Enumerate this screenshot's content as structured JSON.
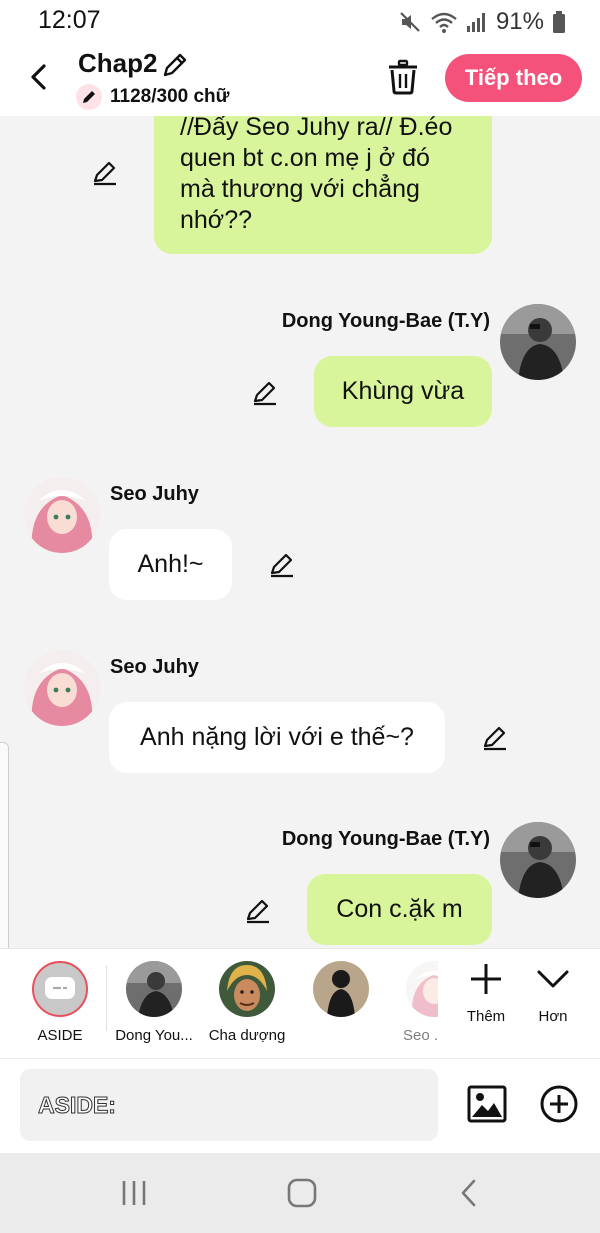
{
  "status_bar": {
    "time": "12:07",
    "battery": "91%",
    "icons": [
      "mute-icon",
      "wifi-icon",
      "signal-icon",
      "battery-icon"
    ]
  },
  "header": {
    "title": "Chap2",
    "word_count": "1128/300 chữ",
    "next_label": "Tiếp theo",
    "accent_color": "#f4527a"
  },
  "messages": [
    {
      "side": "right",
      "text": "//Đấy Seo Juhy ra// Đ.éo quen bt c.on mẹ j ở đó mà thương với chẳng nhớ??"
    },
    {
      "side": "right",
      "sender": "Dong Young-Bae (T.Y)",
      "text": "Khùng vừa"
    },
    {
      "side": "left",
      "sender": "Seo Juhy",
      "text": "Anh!~"
    },
    {
      "side": "left",
      "sender": "Seo Juhy",
      "text": "Anh nặng lời với e thế~?"
    },
    {
      "side": "right",
      "sender": "Dong Young-Bae (T.Y)",
      "text": "Con c.ặk m"
    }
  ],
  "character_bar": {
    "characters": [
      {
        "label": "ASIDE"
      },
      {
        "label": "Dong You..."
      },
      {
        "label": "Cha dượng"
      },
      {
        "label": ""
      },
      {
        "label": "Seo ."
      }
    ],
    "more_label": "Thêm",
    "collapse_label": "Hơn"
  },
  "input": {
    "placeholder": "ASIDE:"
  },
  "colors": {
    "green_bubble": "#d9f59b",
    "white_bubble": "#ffffff",
    "chat_background": "#f3f3f3"
  }
}
